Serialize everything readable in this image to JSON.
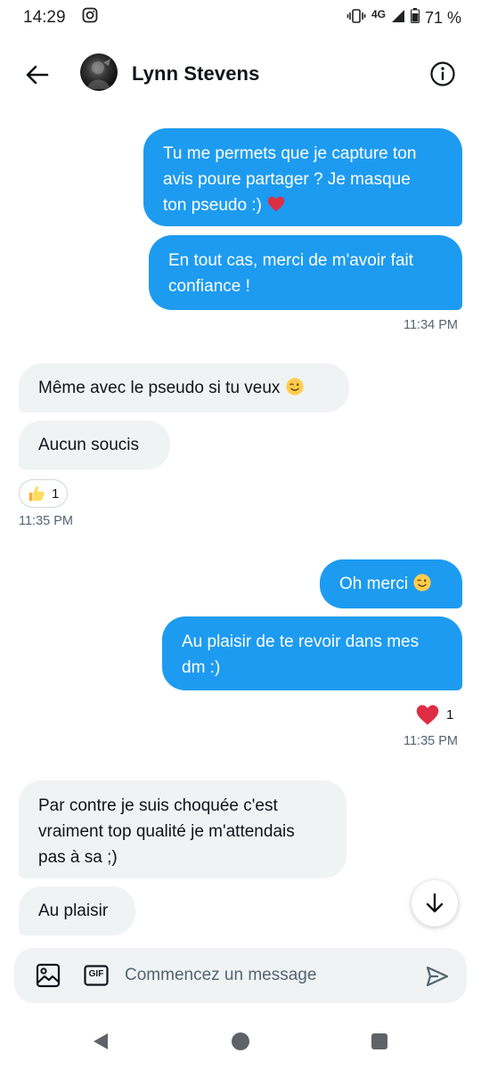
{
  "status_bar": {
    "time": "14:29",
    "network": "4G",
    "battery": "71 %"
  },
  "header": {
    "contact_name": "Lynn Stevens"
  },
  "messages": [
    {
      "direction": "sent",
      "lines": [
        "Tu me permets que je capture ton",
        "avis poure partager ? Je masque",
        "ton pseudo :)"
      ],
      "emoji": "red-heart"
    },
    {
      "direction": "sent",
      "lines": [
        "En tout cas, merci de m'avoir fait",
        "confiance !"
      ]
    },
    {
      "direction": "received",
      "lines": [
        "Même avec le pseudo si tu veux"
      ],
      "emoji": "winking-face"
    },
    {
      "direction": "received",
      "lines": [
        "Aucun soucis"
      ],
      "reaction": {
        "emoji": "thumbs-up",
        "count": "1"
      }
    },
    {
      "direction": "sent",
      "lines": [
        "Oh merci"
      ],
      "emoji": "winking-face"
    },
    {
      "direction": "sent",
      "lines": [
        "Au plaisir de te revoir dans mes",
        "dm :)"
      ],
      "reaction": {
        "emoji": "red-heart",
        "count": "1"
      }
    },
    {
      "direction": "received",
      "lines": [
        "Par contre je suis choquée c'est",
        "vraiment top qualité je m'attendais",
        "pas à sa ;)"
      ]
    },
    {
      "direction": "received",
      "lines": [
        "Au plaisir"
      ]
    }
  ],
  "timestamps": {
    "t1": "11:34 PM",
    "t2": "11:35 PM",
    "t3": "11:35 PM"
  },
  "composer": {
    "placeholder": "Commencez un message",
    "gif_label": "GIF"
  },
  "colors": {
    "sent_bubble": "#1d9bf0",
    "received_bubble": "#eff3f4",
    "heart": "#e0245e"
  }
}
